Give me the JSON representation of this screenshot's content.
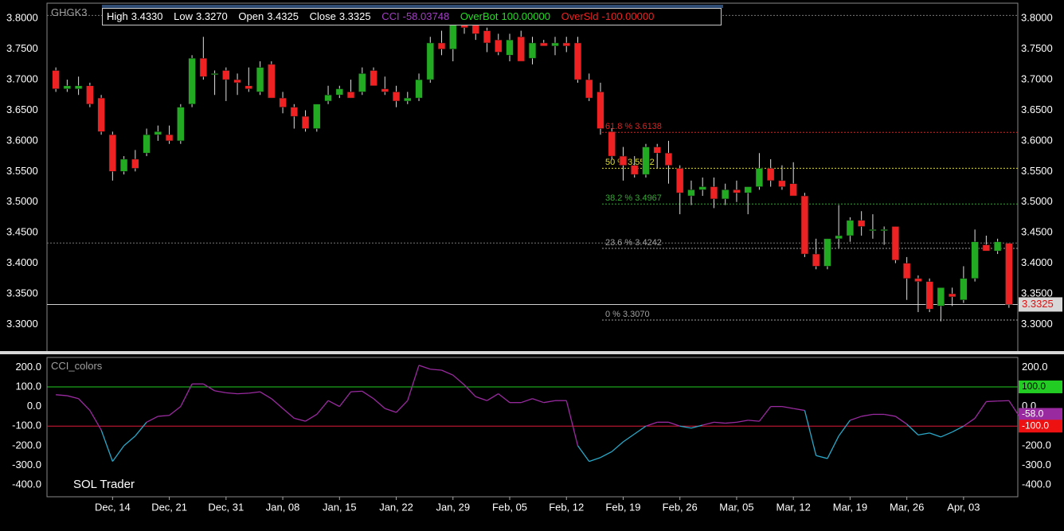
{
  "symbol": "GHGK3",
  "infobar": {
    "high_label": "High",
    "high": "3.4330",
    "low_label": "Low",
    "low": "3.3270",
    "open_label": "Open",
    "open": "3.4325",
    "close_label": "Close",
    "close": "3.3325",
    "cci_label": "CCI",
    "cci": "-58.03748",
    "overbot_label": "OverBot",
    "overbot": "100.00000",
    "oversld_label": "OverSld",
    "oversld": "-100.00000"
  },
  "indicator_name": "CCI_colors",
  "brand": "SOL Trader",
  "colors": {
    "background": "#000000",
    "up": "#22aa22",
    "down": "#ee2222",
    "axis_text": "#ffffff",
    "frame": "#888888",
    "cci_line_above": "#9a2aa0",
    "cci_line_below": "#2aa8c8",
    "overbot_line": "#22cc22",
    "oversld_line": "#dd1a3a",
    "fib_618": "#dd2222",
    "fib_500": "#dddd33",
    "fib_382": "#33aa33",
    "fib_236": "#a0a0a0",
    "fib_0": "#a0a0a0",
    "cci_purple": "#9a2aa0",
    "cci_green": "#22cc22",
    "cci_red": "#ee1111"
  },
  "chart_data": [
    {
      "type": "candlestick",
      "y_ticks": [
        "3.8000",
        "3.7500",
        "3.7000",
        "3.6500",
        "3.6000",
        "3.5500",
        "3.5000",
        "3.4500",
        "3.4000",
        "3.3500",
        "3.3000"
      ],
      "ylim": [
        3.255,
        3.825
      ],
      "x_tick_labels": [
        "Dec, 14",
        "Dec, 21",
        "Dec, 31",
        "Jan, 08",
        "Jan, 15",
        "Jan, 22",
        "Jan, 29",
        "Feb, 05",
        "Feb, 12",
        "Feb, 19",
        "Feb, 26",
        "Mar, 05",
        "Mar, 12",
        "Mar, 19",
        "Mar, 26",
        "Apr, 03"
      ],
      "x_tick_bar_index": [
        5,
        10,
        15,
        20,
        25,
        30,
        35,
        40,
        45,
        50,
        55,
        60,
        65,
        70,
        75,
        80
      ],
      "ohlc": [
        [
          3.715,
          3.72,
          3.68,
          3.685
        ],
        [
          3.685,
          3.7,
          3.68,
          3.69
        ],
        [
          3.685,
          3.705,
          3.675,
          3.69
        ],
        [
          3.69,
          3.695,
          3.655,
          3.66
        ],
        [
          3.67,
          3.675,
          3.61,
          3.615
        ],
        [
          3.61,
          3.615,
          3.535,
          3.55
        ],
        [
          3.55,
          3.575,
          3.545,
          3.57
        ],
        [
          3.57,
          3.585,
          3.55,
          3.555
        ],
        [
          3.58,
          3.62,
          3.575,
          3.61
        ],
        [
          3.61,
          3.625,
          3.6,
          3.615
        ],
        [
          3.61,
          3.625,
          3.595,
          3.6
        ],
        [
          3.6,
          3.66,
          3.595,
          3.655
        ],
        [
          3.66,
          3.74,
          3.655,
          3.735
        ],
        [
          3.735,
          3.77,
          3.7,
          3.705
        ],
        [
          3.71,
          3.715,
          3.675,
          3.71
        ],
        [
          3.715,
          3.72,
          3.665,
          3.7
        ],
        [
          3.7,
          3.71,
          3.675,
          3.695
        ],
        [
          3.69,
          3.72,
          3.68,
          3.685
        ],
        [
          3.68,
          3.73,
          3.675,
          3.72
        ],
        [
          3.725,
          3.73,
          3.67,
          3.67
        ],
        [
          3.67,
          3.68,
          3.645,
          3.655
        ],
        [
          3.655,
          3.66,
          3.62,
          3.64
        ],
        [
          3.64,
          3.65,
          3.615,
          3.62
        ],
        [
          3.62,
          3.66,
          3.615,
          3.66
        ],
        [
          3.665,
          3.69,
          3.66,
          3.675
        ],
        [
          3.675,
          3.69,
          3.67,
          3.685
        ],
        [
          3.68,
          3.7,
          3.67,
          3.67
        ],
        [
          3.68,
          3.72,
          3.675,
          3.71
        ],
        [
          3.715,
          3.72,
          3.69,
          3.69
        ],
        [
          3.685,
          3.705,
          3.675,
          3.68
        ],
        [
          3.68,
          3.69,
          3.655,
          3.665
        ],
        [
          3.665,
          3.68,
          3.66,
          3.67
        ],
        [
          3.67,
          3.71,
          3.665,
          3.7
        ],
        [
          3.7,
          3.77,
          3.695,
          3.76
        ],
        [
          3.76,
          3.78,
          3.74,
          3.75
        ],
        [
          3.75,
          3.8,
          3.73,
          3.795
        ],
        [
          3.8,
          3.805,
          3.775,
          3.785
        ],
        [
          3.79,
          3.795,
          3.765,
          3.775
        ],
        [
          3.78,
          3.785,
          3.745,
          3.76
        ],
        [
          3.765,
          3.775,
          3.74,
          3.745
        ],
        [
          3.74,
          3.775,
          3.73,
          3.765
        ],
        [
          3.77,
          3.78,
          3.73,
          3.73
        ],
        [
          3.735,
          3.77,
          3.725,
          3.76
        ],
        [
          3.76,
          3.765,
          3.755,
          3.755
        ],
        [
          3.755,
          3.77,
          3.74,
          3.76
        ],
        [
          3.76,
          3.77,
          3.745,
          3.755
        ],
        [
          3.76,
          3.77,
          3.695,
          3.7
        ],
        [
          3.7,
          3.71,
          3.665,
          3.67
        ],
        [
          3.68,
          3.695,
          3.61,
          3.62
        ],
        [
          3.615,
          3.62,
          3.57,
          3.575
        ],
        [
          3.575,
          3.59,
          3.535,
          3.56
        ],
        [
          3.56,
          3.575,
          3.54,
          3.545
        ],
        [
          3.545,
          3.595,
          3.54,
          3.59
        ],
        [
          3.59,
          3.595,
          3.555,
          3.58
        ],
        [
          3.58,
          3.6,
          3.53,
          3.56
        ],
        [
          3.555,
          3.56,
          3.48,
          3.515
        ],
        [
          3.51,
          3.535,
          3.495,
          3.52
        ],
        [
          3.52,
          3.54,
          3.51,
          3.525
        ],
        [
          3.525,
          3.54,
          3.49,
          3.505
        ],
        [
          3.505,
          3.53,
          3.495,
          3.52
        ],
        [
          3.52,
          3.535,
          3.5,
          3.515
        ],
        [
          3.515,
          3.52,
          3.48,
          3.525
        ],
        [
          3.525,
          3.58,
          3.52,
          3.555
        ],
        [
          3.555,
          3.57,
          3.525,
          3.535
        ],
        [
          3.535,
          3.56,
          3.52,
          3.525
        ],
        [
          3.53,
          3.565,
          3.51,
          3.51
        ],
        [
          3.51,
          3.515,
          3.41,
          3.415
        ],
        [
          3.415,
          3.44,
          3.39,
          3.395
        ],
        [
          3.395,
          3.44,
          3.39,
          3.44
        ],
        [
          3.44,
          3.495,
          3.425,
          3.445
        ],
        [
          3.445,
          3.475,
          3.435,
          3.47
        ],
        [
          3.47,
          3.485,
          3.445,
          3.46
        ],
        [
          3.455,
          3.48,
          3.44,
          3.455
        ],
        [
          3.455,
          3.46,
          3.43,
          3.455
        ],
        [
          3.46,
          3.46,
          3.4,
          3.405
        ],
        [
          3.4,
          3.41,
          3.34,
          3.375
        ],
        [
          3.375,
          3.38,
          3.32,
          3.37
        ],
        [
          3.37,
          3.375,
          3.32,
          3.325
        ],
        [
          3.33,
          3.36,
          3.305,
          3.36
        ],
        [
          3.35,
          3.36,
          3.33,
          3.345
        ],
        [
          3.34,
          3.395,
          3.335,
          3.375
        ],
        [
          3.375,
          3.455,
          3.37,
          3.435
        ],
        [
          3.43,
          3.445,
          3.42,
          3.42
        ],
        [
          3.42,
          3.44,
          3.415,
          3.435
        ],
        [
          3.4325,
          3.433,
          3.327,
          3.3325
        ]
      ],
      "last_close_label": "3.3325",
      "fib_levels": [
        {
          "label": "61.8 %  3.6138",
          "value": 3.6138,
          "color_key": "fib_618"
        },
        {
          "label": "50 %  3.5552",
          "value": 3.5552,
          "color_key": "fib_500"
        },
        {
          "label": "38.2 %  3.4967",
          "value": 3.4967,
          "color_key": "fib_382"
        },
        {
          "label": "23.6 %  3.4242",
          "value": 3.4242,
          "color_key": "fib_236"
        },
        {
          "label": "0 %  3.3070",
          "value": 3.307,
          "color_key": "fib_0"
        }
      ],
      "fib_start_bar": 48,
      "top_dotted_value": 3.805,
      "recent_dotted_value": 3.433
    },
    {
      "type": "line",
      "name": "CCI_colors",
      "y_ticks": [
        "200.0",
        "100.0",
        "0.0",
        "-100.0",
        "-200.0",
        "-300.0",
        "-400.0"
      ],
      "y_tick_values": [
        200,
        100,
        0,
        -100,
        -200,
        -300,
        -400
      ],
      "ylim": [
        -460,
        250
      ],
      "overbot": 100,
      "oversld": -100,
      "badges": [
        {
          "label": "100.0",
          "value": 100,
          "color_key": "cci_green"
        },
        {
          "label": "-58.0",
          "value": -40,
          "color_key": "cci_purple"
        },
        {
          "label": "-100.0",
          "value": -100,
          "color_key": "cci_red"
        }
      ],
      "values": [
        60,
        55,
        40,
        -20,
        -120,
        -280,
        -200,
        -150,
        -80,
        -50,
        -45,
        0,
        115,
        115,
        80,
        70,
        65,
        68,
        75,
        40,
        -10,
        -60,
        -75,
        -40,
        30,
        0,
        75,
        78,
        40,
        -10,
        -30,
        30,
        210,
        190,
        185,
        160,
        110,
        50,
        30,
        65,
        20,
        20,
        40,
        20,
        30,
        30,
        -200,
        -280,
        -260,
        -230,
        -180,
        -140,
        -100,
        -80,
        -80,
        -100,
        -110,
        -95,
        -80,
        -85,
        -80,
        -70,
        -75,
        0,
        0,
        -10,
        -20,
        -250,
        -265,
        -150,
        -70,
        -50,
        -40,
        -40,
        -50,
        -90,
        -145,
        -135,
        -155,
        -130,
        -100,
        -60,
        25,
        28,
        30,
        -58
      ]
    }
  ]
}
